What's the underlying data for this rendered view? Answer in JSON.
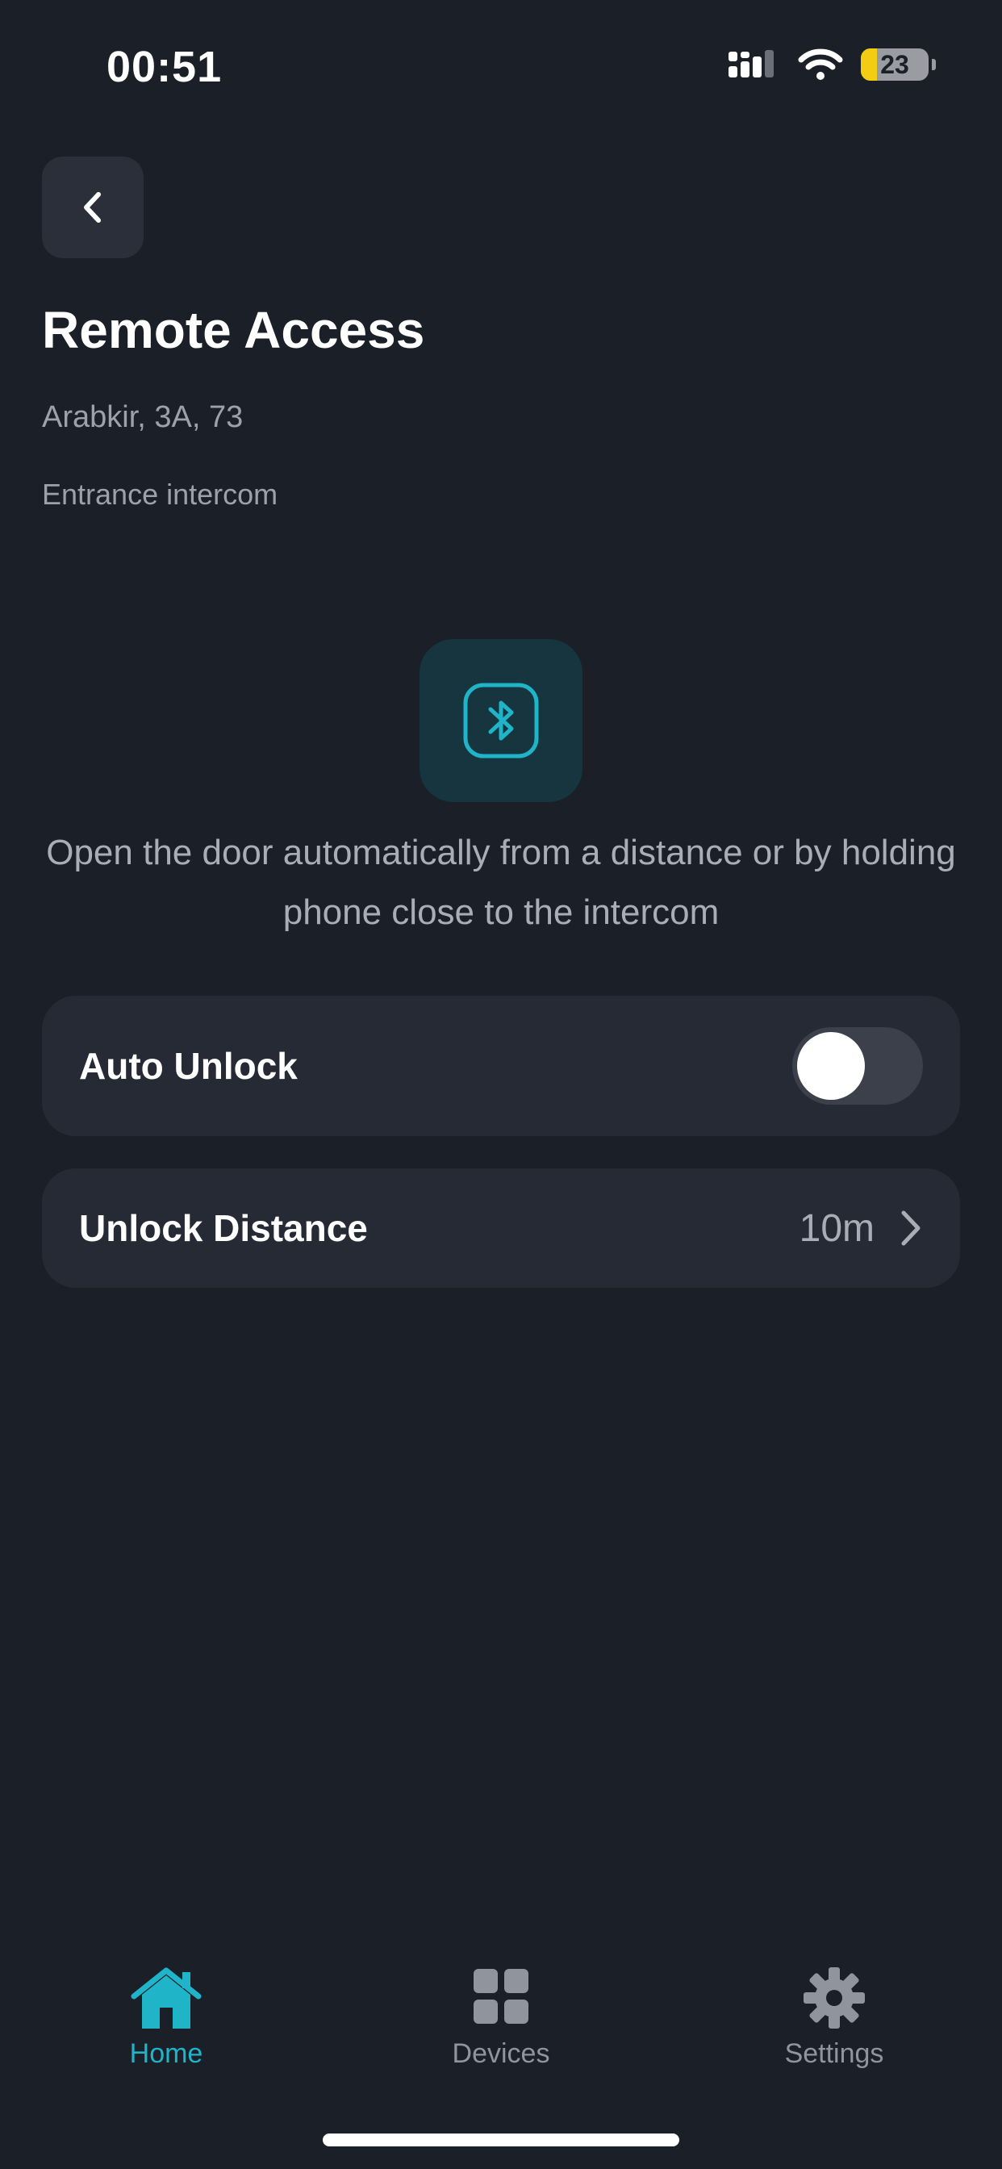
{
  "status_bar": {
    "time": "00:51",
    "battery_level": "23",
    "icons": [
      "cellular-icon",
      "wifi-icon",
      "battery-icon"
    ]
  },
  "header": {
    "back_icon": "chevron-left-icon",
    "title": "Remote Access"
  },
  "location": {
    "address": "Arabkir, 3A, 73",
    "device": "Entrance intercom"
  },
  "feature": {
    "icon": "bluetooth-icon",
    "description": "Open the door automatically from a distance or by holding phone close to the intercom"
  },
  "settings": {
    "auto_unlock": {
      "label": "Auto Unlock",
      "enabled": false
    },
    "unlock_distance": {
      "label": "Unlock Distance",
      "value": "10m"
    }
  },
  "tab_bar": {
    "tabs": [
      {
        "label": "Home",
        "icon": "home-icon",
        "active": true
      },
      {
        "label": "Devices",
        "icon": "grid-icon",
        "active": false
      },
      {
        "label": "Settings",
        "icon": "gear-icon",
        "active": false
      }
    ]
  },
  "colors": {
    "background": "#1b1f27",
    "card": "#252a35",
    "accent": "#1fb4c7",
    "muted_text": "#9ca1ab"
  }
}
